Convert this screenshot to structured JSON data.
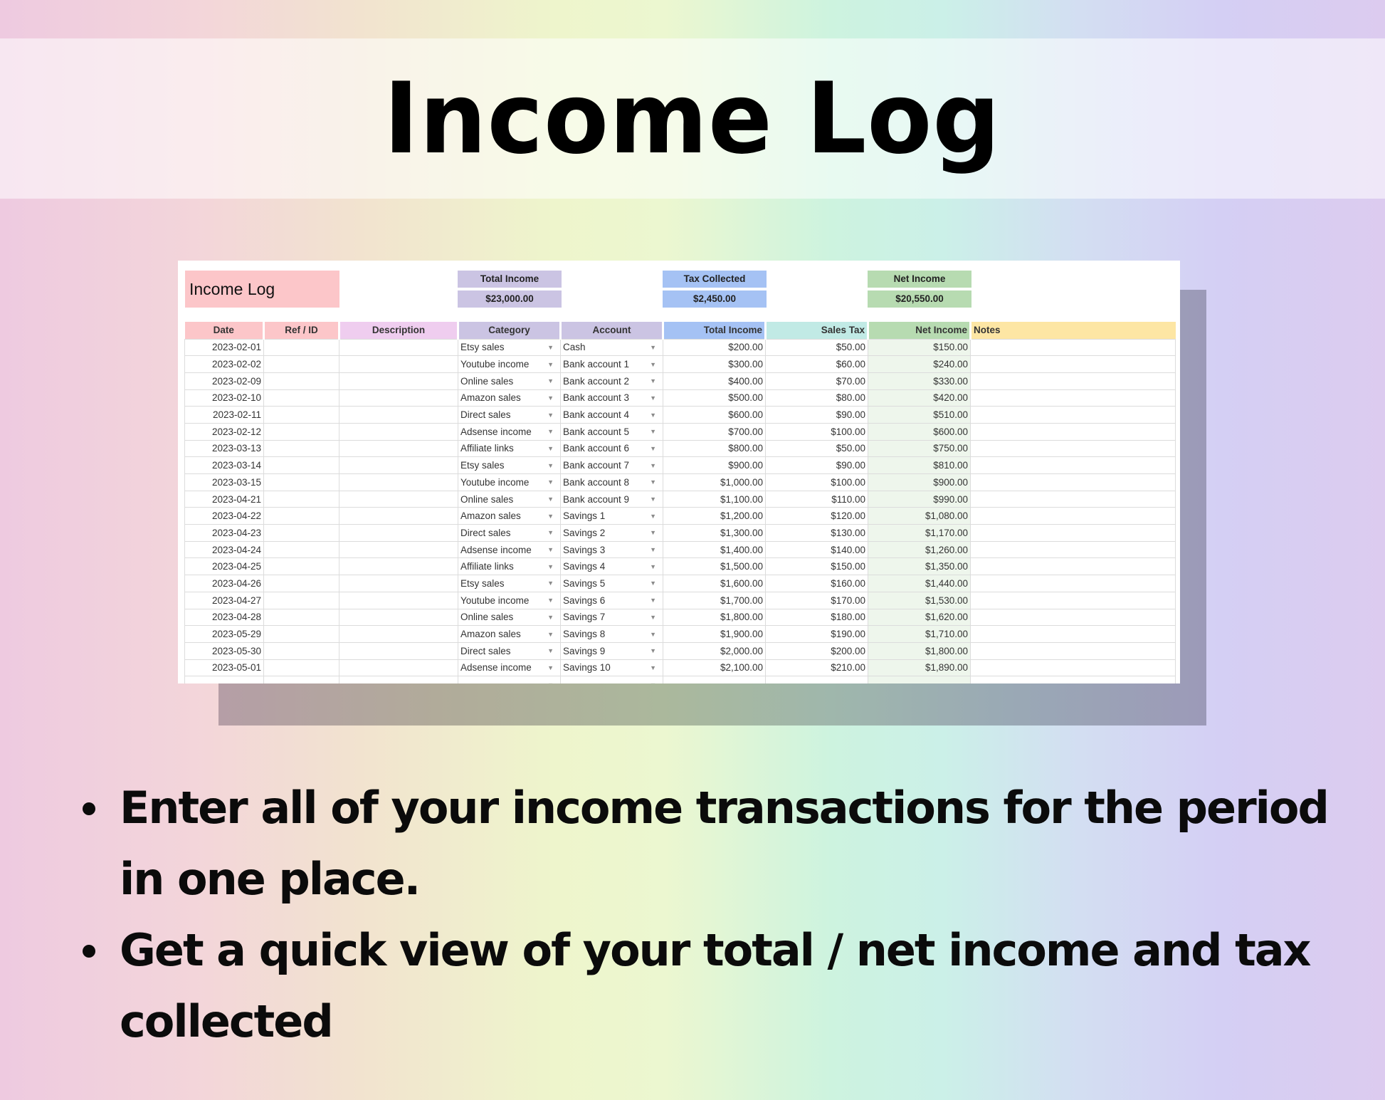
{
  "page_title": "Income Log",
  "sheet": {
    "title": "Income Log",
    "summary": {
      "total_income": {
        "label": "Total Income",
        "value": "$23,000.00"
      },
      "tax_collected": {
        "label": "Tax Collected",
        "value": "$2,450.00"
      },
      "net_income": {
        "label": "Net Income",
        "value": "$20,550.00"
      }
    },
    "columns": [
      "Date",
      "Ref / ID",
      "Description",
      "Category",
      "Account",
      "Total Income",
      "Sales Tax",
      "Net Income",
      "Notes"
    ],
    "header_colors": {
      "date": "#fcc6c9",
      "ref": "#fcc6c9",
      "description": "#efcdef",
      "category": "#cbc4e3",
      "account": "#cbc4e3",
      "total": "#a5c2f4",
      "tax": "#c1eae5",
      "net": "#b7dbb1",
      "notes": "#fde6a4"
    },
    "rows": [
      {
        "date": "2023-02-01",
        "ref": "",
        "description": "",
        "category": "Etsy sales",
        "account": "Cash",
        "total": "$200.00",
        "tax": "$50.00",
        "net": "$150.00",
        "notes": ""
      },
      {
        "date": "2023-02-02",
        "ref": "",
        "description": "",
        "category": "Youtube income",
        "account": "Bank account 1",
        "total": "$300.00",
        "tax": "$60.00",
        "net": "$240.00",
        "notes": ""
      },
      {
        "date": "2023-02-09",
        "ref": "",
        "description": "",
        "category": "Online sales",
        "account": "Bank account 2",
        "total": "$400.00",
        "tax": "$70.00",
        "net": "$330.00",
        "notes": ""
      },
      {
        "date": "2023-02-10",
        "ref": "",
        "description": "",
        "category": "Amazon sales",
        "account": "Bank account 3",
        "total": "$500.00",
        "tax": "$80.00",
        "net": "$420.00",
        "notes": ""
      },
      {
        "date": "2023-02-11",
        "ref": "",
        "description": "",
        "category": "Direct sales",
        "account": "Bank account 4",
        "total": "$600.00",
        "tax": "$90.00",
        "net": "$510.00",
        "notes": ""
      },
      {
        "date": "2023-02-12",
        "ref": "",
        "description": "",
        "category": "Adsense income",
        "account": "Bank account 5",
        "total": "$700.00",
        "tax": "$100.00",
        "net": "$600.00",
        "notes": ""
      },
      {
        "date": "2023-03-13",
        "ref": "",
        "description": "",
        "category": "Affiliate links",
        "account": "Bank account 6",
        "total": "$800.00",
        "tax": "$50.00",
        "net": "$750.00",
        "notes": ""
      },
      {
        "date": "2023-03-14",
        "ref": "",
        "description": "",
        "category": "Etsy sales",
        "account": "Bank account 7",
        "total": "$900.00",
        "tax": "$90.00",
        "net": "$810.00",
        "notes": ""
      },
      {
        "date": "2023-03-15",
        "ref": "",
        "description": "",
        "category": "Youtube income",
        "account": "Bank account 8",
        "total": "$1,000.00",
        "tax": "$100.00",
        "net": "$900.00",
        "notes": ""
      },
      {
        "date": "2023-04-21",
        "ref": "",
        "description": "",
        "category": "Online sales",
        "account": "Bank account 9",
        "total": "$1,100.00",
        "tax": "$110.00",
        "net": "$990.00",
        "notes": ""
      },
      {
        "date": "2023-04-22",
        "ref": "",
        "description": "",
        "category": "Amazon sales",
        "account": "Savings 1",
        "total": "$1,200.00",
        "tax": "$120.00",
        "net": "$1,080.00",
        "notes": ""
      },
      {
        "date": "2023-04-23",
        "ref": "",
        "description": "",
        "category": "Direct sales",
        "account": "Savings 2",
        "total": "$1,300.00",
        "tax": "$130.00",
        "net": "$1,170.00",
        "notes": ""
      },
      {
        "date": "2023-04-24",
        "ref": "",
        "description": "",
        "category": "Adsense income",
        "account": "Savings 3",
        "total": "$1,400.00",
        "tax": "$140.00",
        "net": "$1,260.00",
        "notes": ""
      },
      {
        "date": "2023-04-25",
        "ref": "",
        "description": "",
        "category": "Affiliate links",
        "account": "Savings 4",
        "total": "$1,500.00",
        "tax": "$150.00",
        "net": "$1,350.00",
        "notes": ""
      },
      {
        "date": "2023-04-26",
        "ref": "",
        "description": "",
        "category": "Etsy sales",
        "account": "Savings 5",
        "total": "$1,600.00",
        "tax": "$160.00",
        "net": "$1,440.00",
        "notes": ""
      },
      {
        "date": "2023-04-27",
        "ref": "",
        "description": "",
        "category": "Youtube income",
        "account": "Savings 6",
        "total": "$1,700.00",
        "tax": "$170.00",
        "net": "$1,530.00",
        "notes": ""
      },
      {
        "date": "2023-04-28",
        "ref": "",
        "description": "",
        "category": "Online sales",
        "account": "Savings 7",
        "total": "$1,800.00",
        "tax": "$180.00",
        "net": "$1,620.00",
        "notes": ""
      },
      {
        "date": "2023-05-29",
        "ref": "",
        "description": "",
        "category": "Amazon sales",
        "account": "Savings 8",
        "total": "$1,900.00",
        "tax": "$190.00",
        "net": "$1,710.00",
        "notes": ""
      },
      {
        "date": "2023-05-30",
        "ref": "",
        "description": "",
        "category": "Direct sales",
        "account": "Savings 9",
        "total": "$2,000.00",
        "tax": "$200.00",
        "net": "$1,800.00",
        "notes": ""
      },
      {
        "date": "2023-05-01",
        "ref": "",
        "description": "",
        "category": "Adsense income",
        "account": "Savings 10",
        "total": "$2,100.00",
        "tax": "$210.00",
        "net": "$1,890.00",
        "notes": ""
      },
      {
        "date": "",
        "ref": "",
        "description": "",
        "category": "",
        "account": "",
        "total": "",
        "tax": "",
        "net": "",
        "notes": ""
      }
    ],
    "dropdown_icon": "caret-down-icon"
  },
  "bullets": [
    "Enter all of your income transactions for the period in one place.",
    "Get a quick view of your total / net income and tax collected"
  ]
}
